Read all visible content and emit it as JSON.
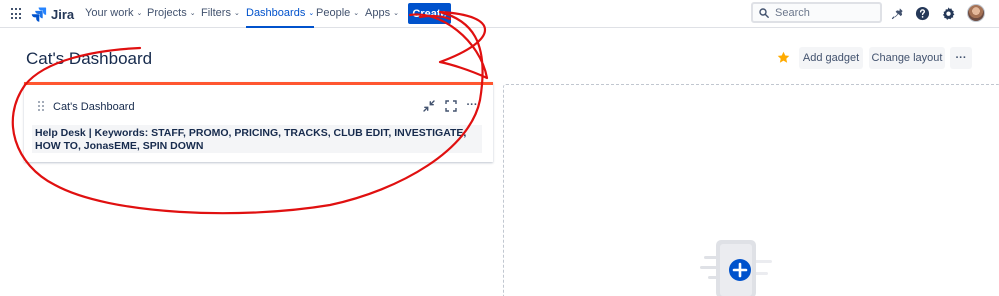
{
  "app": {
    "name": "Jira"
  },
  "nav": {
    "items": [
      {
        "label": "Your work",
        "chevron": "⌄"
      },
      {
        "label": "Projects",
        "chevron": "⌄"
      },
      {
        "label": "Filters",
        "chevron": "⌄"
      },
      {
        "label": "Dashboards",
        "chevron": "⌄"
      },
      {
        "label": "People",
        "chevron": "⌄"
      },
      {
        "label": "Apps",
        "chevron": "⌄"
      }
    ],
    "create_label": "Create",
    "search_placeholder": "Search"
  },
  "page": {
    "title": "Cat's Dashboard",
    "add_gadget_label": "Add gadget",
    "change_layout_label": "Change layout",
    "more_label": "···"
  },
  "gadget": {
    "title": "Cat's Dashboard",
    "more_label": "···",
    "body": "Help Desk | Keywords: STAFF, PROMO, PRICING, TRACKS, CLUB EDIT, INVESTIGATE, HOW TO, JonasEME, SPIN DOWN"
  },
  "colors": {
    "brand": "#0052cc",
    "gadget_accent": "#ff5630",
    "star": "#ffab00",
    "annotation": "#e01010"
  },
  "icons": [
    "app-switcher-icon",
    "jira-logo-icon",
    "search-icon",
    "notifications-icon",
    "help-icon",
    "settings-icon",
    "star-icon",
    "minimize-icon",
    "fullscreen-icon",
    "add-gadget-icon"
  ]
}
